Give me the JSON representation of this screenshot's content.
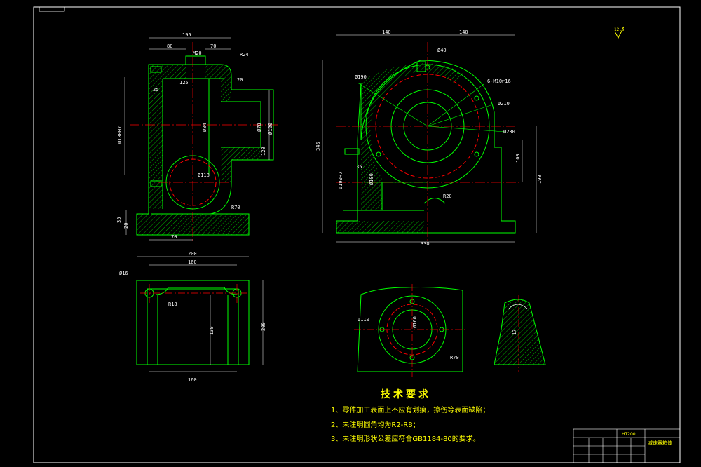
{
  "view_main": {
    "dims": {
      "w195": "195",
      "w80": "80",
      "w70": "70",
      "w125": "125",
      "r24": "R24",
      "v20": "20",
      "v25": "25",
      "m20": "M20",
      "d180": "Ø180H7",
      "d84": "Ø84",
      "d70": "Ø70",
      "d120": "Ø120",
      "v120": "120",
      "d118": "Ø118",
      "r70": "R70",
      "v35": "35",
      "v20b": "20",
      "b70": "70"
    }
  },
  "view_side": {
    "dims": {
      "w140a": "140",
      "w140b": "140",
      "d40": "Ø40",
      "d190": "Ø190",
      "holes": "6-M10□16",
      "d210": "Ø210",
      "d230": "Ø230",
      "h346": "346",
      "d190h7": "Ø190H7",
      "d100": "Ø100",
      "v35": "35",
      "r20": "R20",
      "w330": "330",
      "h190": "190",
      "v100": "100"
    }
  },
  "view_top": {
    "dims": {
      "w200": "200",
      "w160": "160",
      "d16": "Ø16",
      "r18": "R18",
      "v130": "130",
      "v200": "200",
      "b160": "160"
    }
  },
  "view_detail": {
    "dims": {
      "d110": "Ø110",
      "d160": "Ø160",
      "r70": "R70",
      "v17": "17"
    }
  },
  "roughness_mark": "12.5",
  "requirements": {
    "title": "技术要求",
    "items": [
      "1、零件加工表面上不应有划痕，擦伤等表面缺陷；",
      "2、未注明圆角均为R2-R8；",
      "3、未注明形状公差应符合GB1184-80的要求。"
    ]
  },
  "title_block": {
    "material": "HT200",
    "name": "减速器箱体"
  },
  "colors": {
    "background": "#000000",
    "outline": "#00ff00",
    "frame": "#ffffff",
    "centerline": "#ff0000",
    "hatch": "#00ff00",
    "text": "#ffff00"
  }
}
